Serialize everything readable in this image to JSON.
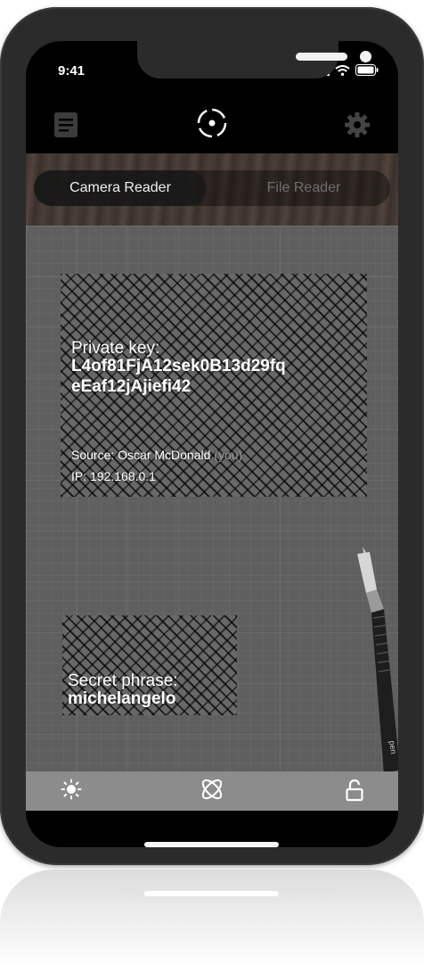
{
  "status": {
    "time": "9:41"
  },
  "toolbar": {
    "left_icon": "document-list-icon",
    "center_icon": "scan-target-icon",
    "right_icon": "gear-icon"
  },
  "tabs": [
    {
      "label": "Camera Reader",
      "active": true
    },
    {
      "label": "File Reader",
      "active": false
    }
  ],
  "card1": {
    "label": "Private key:",
    "value_line1": "L4of81FjA12sek0B13d29fq",
    "value_line2": "eEaf12jAjiefi42",
    "source_prefix": "Source: Oscar McDonald ",
    "source_you": "(you)",
    "ip": "IP: 192.168.0.1"
  },
  "card2": {
    "label": "Secret phrase:",
    "value": "michelangelo"
  },
  "pen_text": "pen",
  "bottom": {
    "left_icon": "brightness-icon",
    "center_icon": "atom-icon",
    "right_icon": "unlock-icon"
  },
  "colors": {
    "scan_bg": "#5f5f5f",
    "bottom_bar": "#8c8c8c",
    "inactive_tab": "#6e6e6e"
  }
}
